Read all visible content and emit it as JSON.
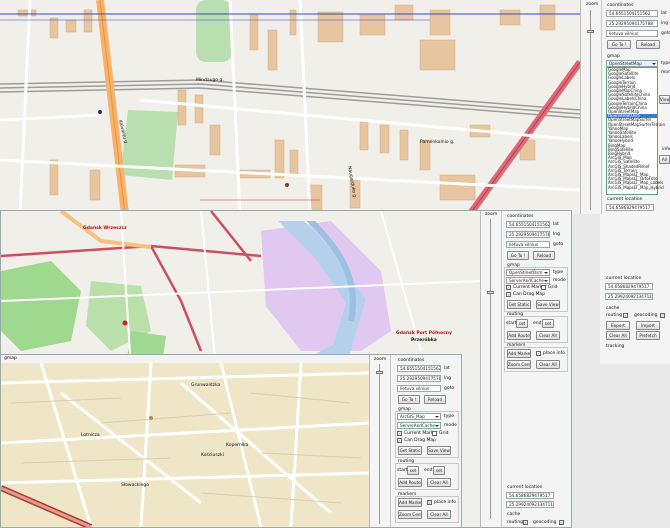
{
  "win1": {
    "zoom_label": "zoom",
    "coordinates_label": "coordinates",
    "lat": "54.6551504151562",
    "lat_unit": "lat",
    "lng": "25.29295094175788",
    "lng_unit": "lng",
    "goto_value": "lietuva vilnius",
    "goto_label": "goto",
    "goto_button": "Go To !",
    "reload_button": "Reload",
    "gmap_label": "gmap",
    "map_type": "OpenStreetMap",
    "type_label": "type",
    "mode_label": "mode",
    "tabs_hint": "View",
    "info_label": "info",
    "all_label": "All",
    "current_location_label": "current location",
    "cur_lat": "54.6586829479517",
    "cur_lng": "25.29924092134711",
    "cache_label": "cache",
    "routing_cb": "routing",
    "geocoding_cb": "geocoding",
    "export_button": "Export",
    "import_button": "Import",
    "clearall_button": "Clear All",
    "prefetch_button": "Prefetch",
    "tracking_label": "tracking",
    "provider_list": [
      "GoogleMap",
      "GoogleSatellite",
      "GoogleLabels",
      "GoogleTerrain",
      "GoogleHybrid",
      "GoogleMapChina",
      "GoogleSatelliteChina",
      "GoogleLabelsChina",
      "GoogleTerrainChina",
      "GoogleHybridChina",
      "OpenStreetMap",
      "OpenStreetOsm",
      "OpenStreetMapSurfer",
      "OpenStreetMapSurferTerrain",
      "YahooMap",
      "YahooSatellite",
      "YahooLabels",
      "YahooHybrid",
      "BingMap",
      "BingSatellite",
      "BingHybrid",
      "ArcGIS_Map",
      "ArcGIS_Satellite",
      "ArcGIS_ShadedRelief",
      "ArcGIS_Terrain",
      "ArcGIS_MapsLT_Map",
      "ArcGIS_MapsLT_OrtoFoto",
      "ArcGIS_MapsLT_Map_Labels",
      "ArcGIS_MapsLT_Map_Hybrid"
    ],
    "provider_selected_index": 11,
    "map_labels": [
      "Mindaugo g.",
      "Pamėnkalnio g.",
      "Kalvarijų g.",
      "Naugarduko g."
    ]
  },
  "win2": {
    "zoom_label": "zoom",
    "coordinates_label": "coordinates",
    "lat": "54.6551504151562",
    "lat_unit": "lat",
    "lng": "25.29295094175788",
    "lng_unit": "lng",
    "goto_value": "lietuva vilnius",
    "goto_label": "goto",
    "goto_button": "Go To !",
    "reload_button": "Reload",
    "gmap_label": "gmap",
    "map_type": "OpenStreetOsm",
    "type_label": "type",
    "mode_value": "ServerAndCache",
    "mode_label": "mode",
    "current_marker_cb": "Current Marker",
    "grid_cb": "Grid",
    "can_drag_cb": "Can Drag Map",
    "get_static_button": "Get Static",
    "save_view_button": "Save View",
    "routing_label": "routing",
    "start_label": "start",
    "set_label": "set",
    "end_label": "end",
    "add_route_button": "Add Route",
    "clear_all_button": "Clear All",
    "markers_label": "markers",
    "add_marker_button": "Add Marker",
    "place_info_cb": "place info",
    "zoom_center_button": "Zoom Center",
    "current_location_label": "current location",
    "cur_lat": "54.6586829479517",
    "cur_lng": "25.29924092134711",
    "cache_label": "cache",
    "routing_cb": "routing",
    "geocoding_cb": "geocoding",
    "export_button": "Export",
    "import_button": "Import",
    "clearall_button": "Clear All",
    "prefetch_button": "Prefetch",
    "tracking_label": "tracking",
    "map_labels": [
      "Gdańsk Wrzeszcz",
      "Gdańsk Port Północny",
      "Przeróbka"
    ]
  },
  "win3": {
    "title": "gmap",
    "zoom_label": "zoom",
    "coordinates_label": "coordinates",
    "lat": "54.6551504151562",
    "lat_unit": "lat",
    "lng": "25.29295094175788",
    "lng_unit": "lng",
    "goto_value": "lietuva vilnius",
    "goto_label": "goto",
    "goto_button": "Go To !",
    "reload_button": "Reload",
    "gmap_label": "gmap",
    "map_type": "ArcGIS_Map",
    "type_label": "type",
    "mode_value": "ServerAndCache",
    "mode_label": "mode",
    "current_marker_cb": "Current Marker",
    "grid_cb": "Grid",
    "can_drag_cb": "Can Drag Map",
    "get_static_button": "Get Static",
    "save_view_button": "Save View",
    "routing_label": "routing",
    "start_label": "start",
    "set_label": "set",
    "end_label": "end",
    "add_route_button": "Add Route",
    "clear_all_button": "Clear All",
    "markers_label": "markers",
    "add_marker_button": "Add Marker",
    "place_info_cb": "place info",
    "zoom_center_button": "Zoom Center",
    "clear_markers_button": "Clear All",
    "map_labels": [
      "Grunwaldzka",
      "Kościuszki",
      "Kopernika",
      "Lotnicza",
      "Słowackiego"
    ]
  },
  "colors": {
    "osm_bg": "#f1efe9",
    "building": "#e7c5a0",
    "park": "#aedfa0",
    "rail": "#999999",
    "highway": "#e67a82",
    "arcgis_bg": "#efe6c8",
    "water": "#c8b4e8"
  }
}
